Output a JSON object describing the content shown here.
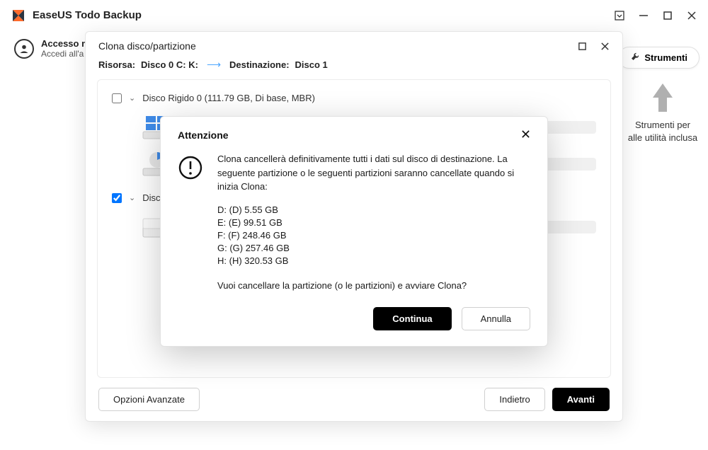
{
  "app": {
    "title": "EaseUS Todo Backup"
  },
  "account": {
    "line1": "Accesso n",
    "line2": "Accedi all'a"
  },
  "tools": {
    "label": "Strumenti"
  },
  "right_hint": "Strumenti per alle utilità inclusa",
  "clone": {
    "title": "Clona disco/partizione",
    "source_label": "Risorsa:",
    "source_value": "Disco 0 C: K:",
    "dest_label": "Destinazione:",
    "dest_value": "Disco 1",
    "disk0_label": "Disco Rigido 0 (111.79 GB, Di base, MBR)",
    "disk0_checked": false,
    "disk1_label": "Disco",
    "disk1_checked": true,
    "advanced": "Opzioni Avanzate",
    "back": "Indietro",
    "next": "Avanti"
  },
  "attention": {
    "title": "Attenzione",
    "warning": "Clona cancellerà definitivamente tutti i dati sul disco di destinazione. La seguente partizione o le seguenti partizioni saranno cancellate quando si inizia Clona:",
    "partitions": [
      "D: (D) 5.55 GB",
      "E: (E) 99.51 GB",
      "F: (F) 248.46 GB",
      "G: (G) 257.46 GB",
      "H: (H) 320.53 GB"
    ],
    "confirm_question": "Vuoi cancellare la partizione (o le partizioni) e avviare Clona?",
    "continue": "Continua",
    "cancel": "Annulla"
  }
}
